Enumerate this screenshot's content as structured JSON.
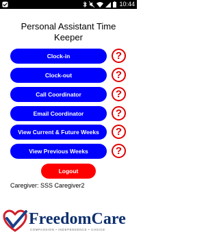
{
  "statusbar": {
    "time": "10:44",
    "icons": [
      "bluetooth-icon",
      "mute-icon",
      "wifi-icon",
      "signal-icon",
      "battery-icon"
    ]
  },
  "title_line1": "Personal Assistant Time",
  "title_line2": "Keeper",
  "menu": [
    {
      "label": "Clock-in"
    },
    {
      "label": "Clock-out"
    },
    {
      "label": "Call Coordinator"
    },
    {
      "label": "Email Coordinator"
    },
    {
      "label": "View Current & Future Weeks"
    },
    {
      "label": "View Previous Weeks"
    }
  ],
  "help_glyph": "?",
  "logout_label": "Logout",
  "caregiver_text": "Caregiver: SSS Caregiver2",
  "logo": {
    "text": "FreedomCare",
    "tagline": "COMPASSION • INDEPENDENCE • CHOICE"
  },
  "colors": {
    "primary_button": "#0000ff",
    "logout_button": "#ff0000",
    "help_icon": "#e00000",
    "logo_text": "#0d2f6e"
  }
}
